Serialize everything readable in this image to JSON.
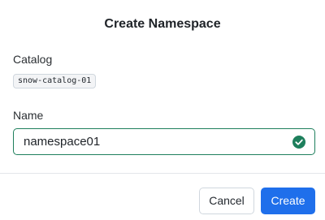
{
  "dialog": {
    "title": "Create Namespace",
    "catalog": {
      "label": "Catalog",
      "value": "snow-catalog-01"
    },
    "name": {
      "label": "Name",
      "value": "namespace01",
      "valid_icon": "check-circle-icon"
    },
    "actions": {
      "cancel_label": "Cancel",
      "create_label": "Create"
    }
  },
  "colors": {
    "primary": "#1f6feb",
    "success": "#1e7f5c"
  }
}
